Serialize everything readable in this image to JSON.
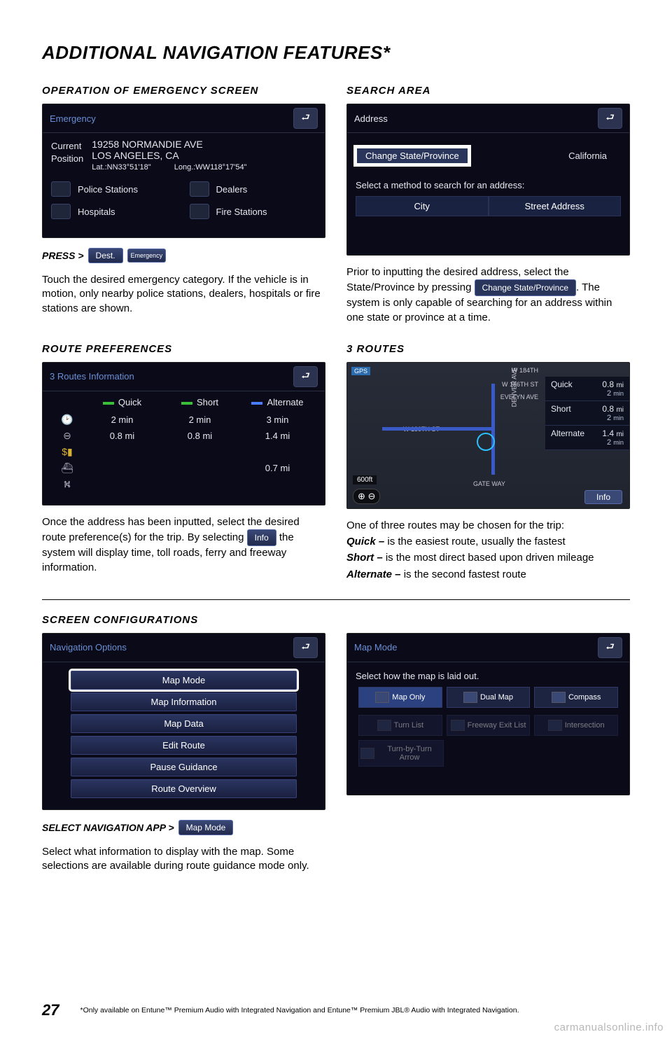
{
  "page": {
    "title": "ADDITIONAL NAVIGATION FEATURES*",
    "number": "27",
    "footnote": "*Only available on Entune™ Premium Audio with Integrated Navigation and Entune™ Premium JBL® Audio with Integrated Navigation.",
    "watermark": "carmanualsonline.info"
  },
  "emergency": {
    "title": "OPERATION OF EMERGENCY SCREEN",
    "header": "Emergency",
    "pos_label1": "Current",
    "pos_label2": "Position",
    "addr1": "19258 NORMANDIE AVE",
    "addr2": "LOS ANGELES, CA",
    "lat": "Lat.:NN33°51'18\"",
    "lon": "Long.:WW118°17'54\"",
    "items": [
      "Police Stations",
      "Dealers",
      "Hospitals",
      "Fire Stations"
    ],
    "press_label": "PRESS >",
    "btn_dest": "Dest.",
    "btn_emg": "Emergency",
    "body": "Touch the desired emergency category. If the vehicle is in motion, only nearby police stations, dealers, hospitals or fire stations are shown."
  },
  "search": {
    "title": "SEARCH AREA",
    "header": "Address",
    "csp": "Change State/Province",
    "state": "California",
    "prompt": "Select a method to search for an address:",
    "btn_city": "City",
    "btn_street": "Street Address",
    "body_pre": "Prior to inputting the desired address, select the State/Province by pressing ",
    "btn_inline": "Change State/Province",
    "body_post": ". The system is only capable of searching for an address within one state or province at a time."
  },
  "routeprefs": {
    "title": "ROUTE PREFERENCES",
    "header": "3 Routes Information",
    "cols": [
      "Quick",
      "Short",
      "Alternate"
    ],
    "row_time": [
      "2 min",
      "2 min",
      "3 min"
    ],
    "row_dist": [
      "0.8 mi",
      "0.8 mi",
      "1.4 mi"
    ],
    "row_last": [
      "",
      "",
      "0.7 mi"
    ],
    "body_pre": "Once the address has been inputted, select the desired route preference(s) for the trip. By selecting ",
    "btn_info": "Info",
    "body_post": " the system will display time, toll roads, ferry and freeway information."
  },
  "threeroutes": {
    "title": "3 ROUTES",
    "streets": [
      "W 184TH",
      "W 186TH ST",
      "EVELYN AVE",
      "W 190TH ST",
      "DENVER AVE",
      "GATE WAY"
    ],
    "routes": [
      {
        "name": "Quick",
        "dist": "0.8",
        "unit_d": "mi",
        "time": "2",
        "unit_t": "min"
      },
      {
        "name": "Short",
        "dist": "0.8",
        "unit_d": "mi",
        "time": "2",
        "unit_t": "min"
      },
      {
        "name": "Alternate",
        "dist": "1.4",
        "unit_d": "mi",
        "time": "2",
        "unit_t": "min"
      }
    ],
    "scale": "600ft",
    "zoom_plus": "⊕",
    "zoom_minus": "⊖",
    "info": "Info",
    "gps": "GPS",
    "body_intro": "One of three routes may be chosen for the trip:",
    "desc": [
      {
        "b": "Quick – ",
        "t": "is the easiest route, usually the fastest"
      },
      {
        "b": "Short – ",
        "t": "is the most direct based upon driven mileage"
      },
      {
        "b": "Alternate – ",
        "t": "is the second fastest route"
      }
    ]
  },
  "screenconf": {
    "title": "SCREEN CONFIGURATIONS",
    "nav_header": "Navigation Options",
    "opts": [
      "Map Mode",
      "Map Information",
      "Map Data",
      "Edit Route",
      "Pause Guidance",
      "Route Overview"
    ],
    "mapmode_header": "Map Mode",
    "mapmode_prompt": "Select how the map is laid out.",
    "mm_row1": [
      "Map Only",
      "Dual Map",
      "Compass"
    ],
    "mm_row2": [
      "Turn List",
      "Freeway Exit List",
      "Intersection"
    ],
    "mm_row3": [
      "Turn-by-Turn Arrow"
    ],
    "select_label": "SELECT NAVIGATION APP >",
    "btn_mapmode": "Map Mode",
    "body": "Select what information to display with the map. Some selections are available during route guidance mode only."
  }
}
